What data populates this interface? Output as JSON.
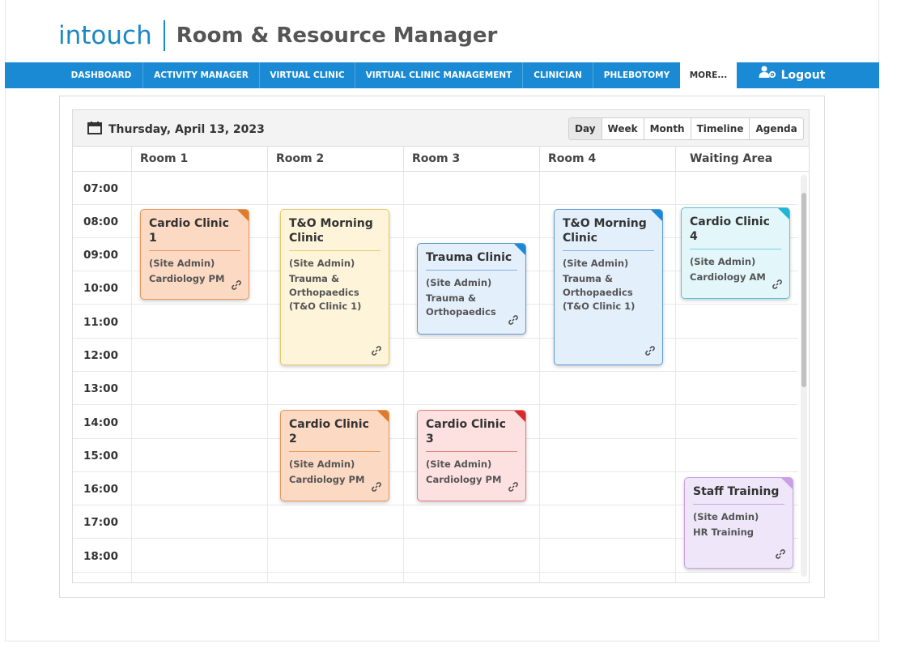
{
  "header": {
    "logo": "intouch",
    "app_title": "Room & Resource Manager"
  },
  "nav": {
    "items": [
      {
        "label": "DASHBOARD"
      },
      {
        "label": "ACTIVITY MANAGER"
      },
      {
        "label": "VIRTUAL CLINIC"
      },
      {
        "label": "VIRTUAL CLINIC MANAGEMENT"
      },
      {
        "label": "CLINICIAN"
      },
      {
        "label": "PHLEBOTOMY"
      },
      {
        "label": "MORE..."
      }
    ],
    "logout": "Logout"
  },
  "scheduler": {
    "date": "Thursday, April 13, 2023",
    "views": [
      "Day",
      "Week",
      "Month",
      "Timeline",
      "Agenda"
    ],
    "active_view": "Day",
    "columns": [
      "Room 1",
      "Room 2",
      "Room 3",
      "Room 4",
      "Waiting Area"
    ],
    "times": [
      "07:00",
      "08:00",
      "09:00",
      "10:00",
      "11:00",
      "12:00",
      "13:00",
      "14:00",
      "15:00",
      "16:00",
      "17:00",
      "18:00"
    ],
    "events": [
      {
        "title": "Cardio Clinic 1",
        "owner": "(Site Admin)",
        "desc": "Cardiology PM",
        "color": "orange",
        "corner": "#e07b2c"
      },
      {
        "title": "T&O Morning Clinic",
        "owner": "(Site Admin)",
        "desc": "Trauma & Orthopaedics (T&O Clinic 1)",
        "color": "yellow",
        "corner": "#fdf4d9"
      },
      {
        "title": "Trauma Clinic",
        "owner": "(Site Admin)",
        "desc": "Trauma & Orthopaedics",
        "color": "blue",
        "corner": "#1a87d8"
      },
      {
        "title": "T&O Morning Clinic",
        "owner": "(Site Admin)",
        "desc": "Trauma & Orthopaedics (T&O Clinic 1)",
        "color": "blue",
        "corner": "#1a87d8"
      },
      {
        "title": "Cardio Clinic 4",
        "owner": "(Site Admin)",
        "desc": "Cardiology AM",
        "color": "cyan",
        "corner": "#1fb5d6"
      },
      {
        "title": "Cardio Clinic 2",
        "owner": "(Site Admin)",
        "desc": "Cardiology PM",
        "color": "orange",
        "corner": "#e07b2c"
      },
      {
        "title": "Cardio Clinic 3",
        "owner": "(Site Admin)",
        "desc": "Cardiology PM",
        "color": "red",
        "corner": "#d62a2a"
      },
      {
        "title": "Staff Training",
        "owner": "(Site Admin)",
        "desc": "HR Training",
        "color": "purple",
        "corner": "#c9a0e8"
      }
    ]
  }
}
